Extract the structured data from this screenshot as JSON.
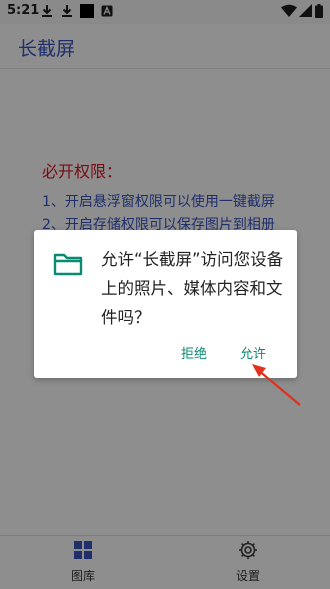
{
  "status_bar": {
    "time": "5:21",
    "left_icons": [
      "download-icon",
      "download-icon",
      "black-square-icon",
      "a-box-icon"
    ],
    "right_icons": [
      "wifi-icon",
      "signal-icon",
      "battery-icon"
    ]
  },
  "header": {
    "title": "长截屏"
  },
  "permissions": {
    "heading": "必开权限：",
    "items": [
      "1、开启悬浮窗权限可以使用一键截屏",
      "2、开启存储权限可以保存图片到相册"
    ]
  },
  "dialog": {
    "icon": "folder-icon",
    "message": "允许“长截屏”访问您设备上的照片、媒体内容和文件吗？",
    "deny_label": "拒绝",
    "allow_label": "允许",
    "accent_color": "#0a8a73"
  },
  "annotation": {
    "arrow_color": "#e0301e"
  },
  "bottom_nav": [
    {
      "icon": "grid-icon",
      "label": "图库"
    },
    {
      "icon": "gear-icon",
      "label": "设置"
    }
  ]
}
